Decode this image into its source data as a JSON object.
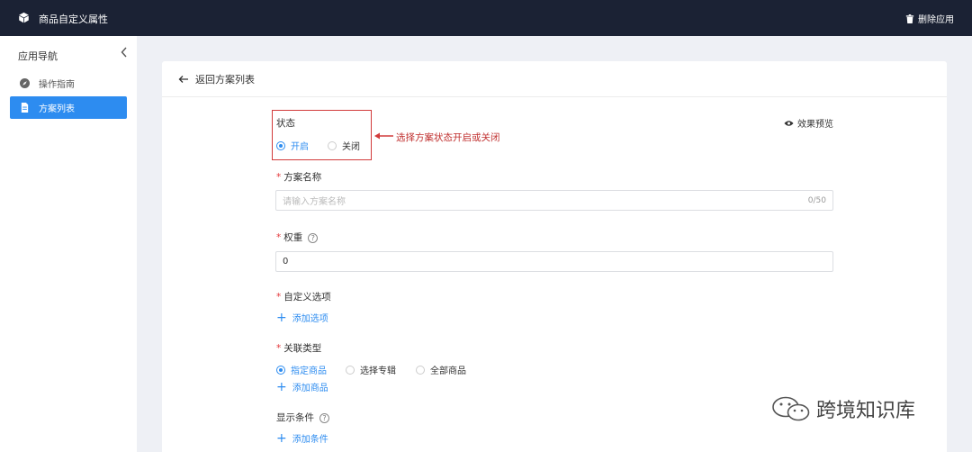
{
  "header": {
    "title": "商品自定义属性",
    "delete_app": "删除应用"
  },
  "sidebar": {
    "heading": "应用导航",
    "items": [
      {
        "label": "操作指南",
        "icon": "compass-icon",
        "active": false
      },
      {
        "label": "方案列表",
        "icon": "document-icon",
        "active": true
      }
    ]
  },
  "page": {
    "back_label": "返回方案列表",
    "preview_label": "效果预览",
    "status": {
      "label": "状态",
      "options": [
        "开启",
        "关闭"
      ],
      "selected": "开启"
    },
    "annotation": "选择方案状态开启或关闭",
    "scheme_name": {
      "label": "方案名称",
      "required": true,
      "placeholder": "请输入方案名称",
      "counter": "0/50"
    },
    "weight": {
      "label": "权重",
      "required": true,
      "value": "0",
      "help": "?"
    },
    "custom_options": {
      "label": "自定义选项",
      "required": true,
      "add_label": "添加选项"
    },
    "relation_type": {
      "label": "关联类型",
      "required": true,
      "options": [
        "指定商品",
        "选择专辑",
        "全部商品"
      ],
      "selected": "指定商品",
      "add_label": "添加商品"
    },
    "display_condition": {
      "label": "显示条件",
      "help": "?",
      "add_label": "添加条件"
    }
  },
  "watermark": "跨境知识库",
  "colors": {
    "topbar": "#1b2234",
    "accent": "#2d8cf0",
    "annotation": "#d23b3b",
    "required": "#e4393c"
  }
}
